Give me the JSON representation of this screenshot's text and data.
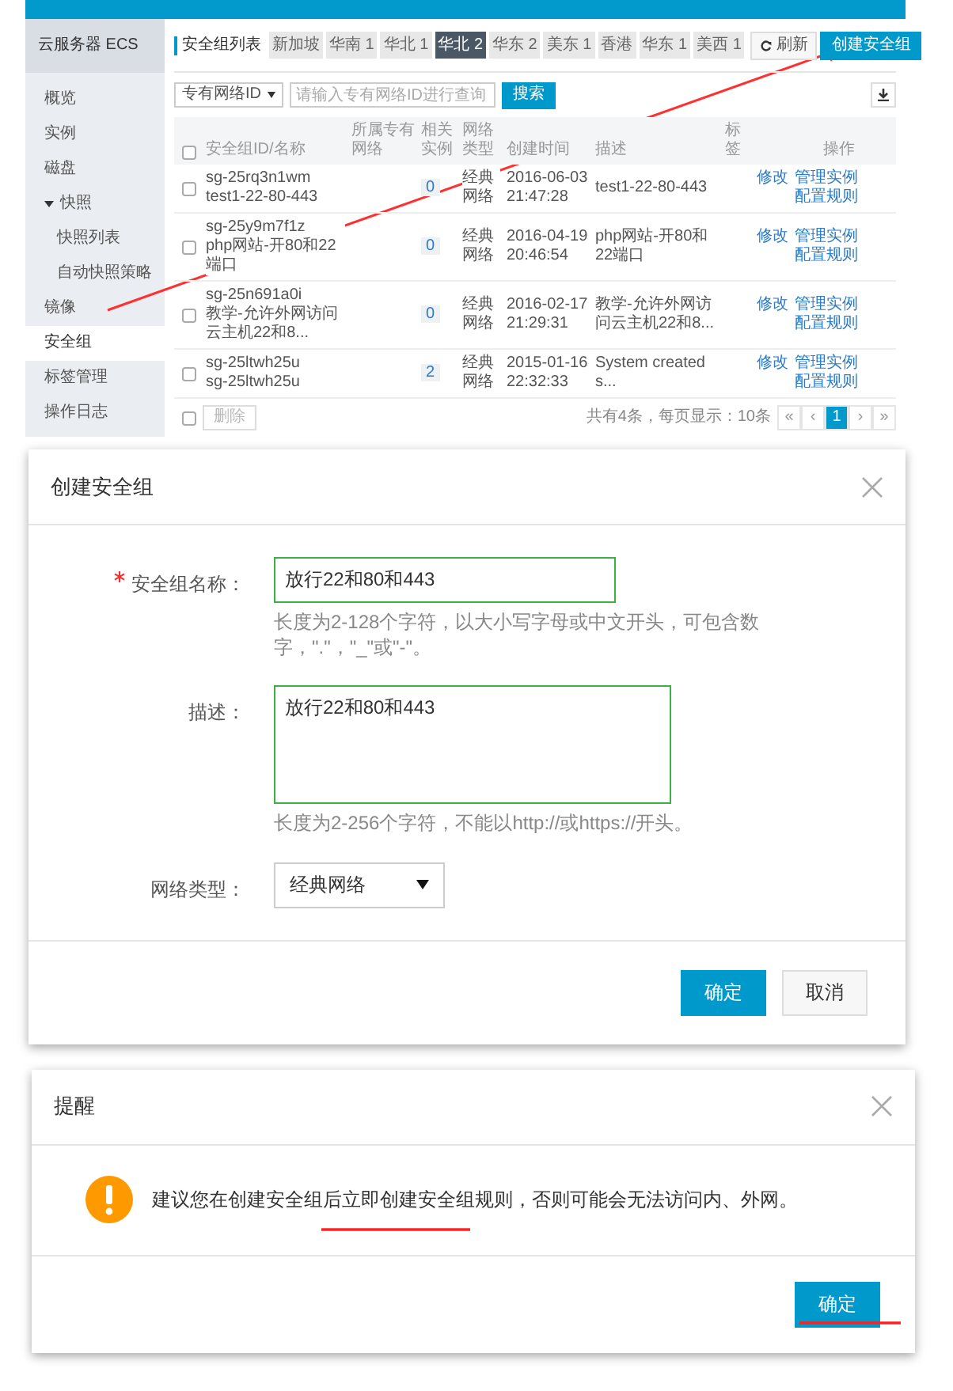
{
  "console": {
    "sidebar": {
      "title": "云服务器 ECS",
      "items": [
        {
          "label": "概览",
          "selected": false
        },
        {
          "label": "实例",
          "selected": false
        },
        {
          "label": "磁盘",
          "selected": false
        },
        {
          "label": "快照",
          "selected": false,
          "expanded": true,
          "children": [
            {
              "label": "快照列表",
              "selected": false
            },
            {
              "label": "自动快照策略",
              "selected": false
            }
          ]
        },
        {
          "label": "镜像",
          "selected": false
        },
        {
          "label": "安全组",
          "selected": true
        },
        {
          "label": "标签管理",
          "selected": false
        },
        {
          "label": "操作日志",
          "selected": false
        }
      ]
    },
    "page_title": "安全组列表",
    "regions": [
      {
        "label": "新加坡",
        "selected": false
      },
      {
        "label": "华南 1",
        "selected": false
      },
      {
        "label": "华北 1",
        "selected": false
      },
      {
        "label": "华北 2",
        "selected": true
      },
      {
        "label": "华东 2",
        "selected": false
      },
      {
        "label": "美东 1",
        "selected": false
      },
      {
        "label": "香港",
        "selected": false
      },
      {
        "label": "华东 1",
        "selected": false
      },
      {
        "label": "美西 1",
        "selected": false
      }
    ],
    "refresh_button": "刷新",
    "create_button": "创建安全组",
    "filter_select": "专有网络ID",
    "search_placeholder": "请输入专有网络ID进行查询",
    "search_button": "搜索",
    "table": {
      "header_checked": false,
      "columns": [
        "安全组ID/名称",
        "所属专有网络",
        "相关实例",
        "网络类型",
        "创建时间",
        "描述",
        "标签",
        "操作"
      ],
      "rows": [
        {
          "checked": false,
          "id": "sg-25rq3n1wm",
          "name": "test1-22-80-443",
          "instances": "0",
          "network": "经典网络",
          "created": "2016-06-03 21:47:28",
          "description": "test1-22-80-443",
          "actions": [
            "修改",
            "管理实例",
            "配置规则"
          ]
        },
        {
          "checked": false,
          "id": "sg-25y9m7f1z",
          "name": "php网站-开80和22端口",
          "instances": "0",
          "network": "经典网络",
          "created": "2016-04-19 20:46:54",
          "description": "php网站-开80和22端口",
          "actions": [
            "修改",
            "管理实例",
            "配置规则"
          ]
        },
        {
          "checked": false,
          "id": "sg-25n691a0i",
          "name": "教学-允许外网访问云主机22和8...",
          "instances": "0",
          "network": "经典网络",
          "created": "2016-02-17 21:29:31",
          "description": "教学-允许外网访问云主机22和8...",
          "actions": [
            "修改",
            "管理实例",
            "配置规则"
          ]
        },
        {
          "checked": false,
          "id": "sg-25ltwh25u",
          "name": "sg-25ltwh25u",
          "instances": "2",
          "network": "经典网络",
          "created": "2015-01-16 22:32:33",
          "description": "System created s...",
          "actions": [
            "修改",
            "管理实例",
            "配置规则"
          ]
        }
      ]
    },
    "footer_checked": false,
    "delete_button": "删除",
    "summary": "共有4条，每页显示：10条",
    "pagination": [
      {
        "label": "«",
        "selected": false
      },
      {
        "label": "‹",
        "selected": false
      },
      {
        "label": "1",
        "selected": true
      },
      {
        "label": "›",
        "selected": false
      },
      {
        "label": "»",
        "selected": false
      }
    ]
  },
  "create_dialog": {
    "title": "创建安全组",
    "fields": [
      {
        "kind": "input",
        "required": true,
        "label": "安全组名称：",
        "value": "放行22和80和443",
        "hint": "长度为2-128个字符，以大小写字母或中文开头，可包含数字，\".\"，\"_\"或\"-\"。"
      },
      {
        "kind": "textarea",
        "required": false,
        "label": "描述：",
        "value": "放行22和80和443",
        "hint": "长度为2-256个字符，不能以http://或https://开头。"
      },
      {
        "kind": "select",
        "required": false,
        "label": "网络类型：",
        "value": "经典网络"
      }
    ],
    "ok_button": "确定",
    "cancel_button": "取消"
  },
  "alert_dialog": {
    "title": "提醒",
    "message": "建议您在创建安全组后立即创建安全组规则，否则可能会无法访问内、外网。",
    "ok_button": "确定"
  }
}
